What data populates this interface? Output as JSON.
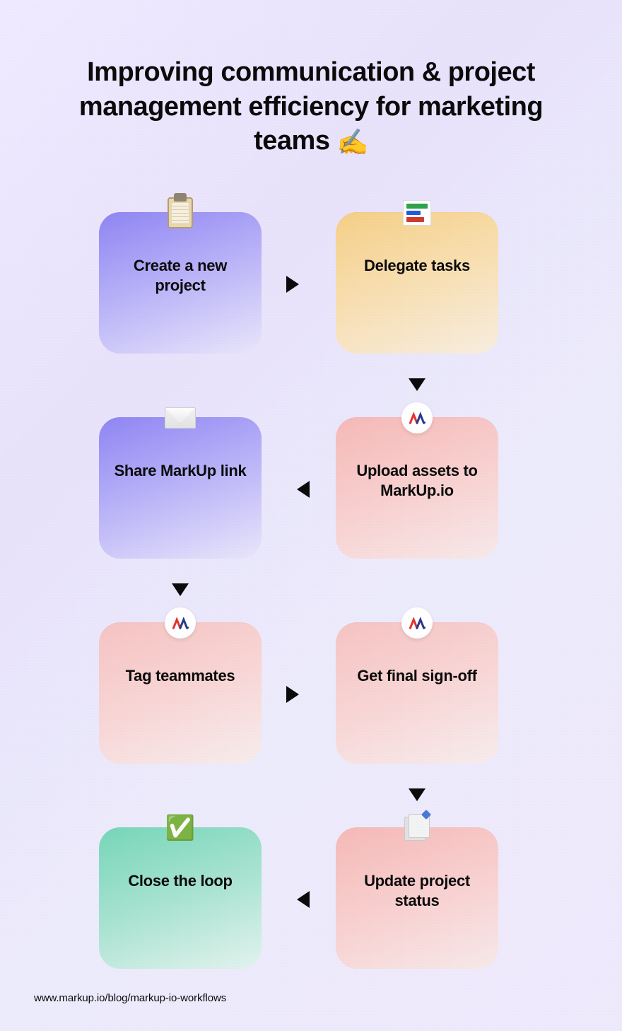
{
  "title": {
    "text": "Improving communication & project management efficiency for marketing teams",
    "emoji": "✍️"
  },
  "steps": [
    {
      "id": "create-project",
      "label": "Create a new project",
      "icon": "clipboard-icon",
      "color": "purple"
    },
    {
      "id": "delegate-tasks",
      "label": "Delegate tasks",
      "icon": "bars-icon",
      "color": "orange"
    },
    {
      "id": "upload-assets",
      "label": "Upload assets to MarkUp.io",
      "icon": "markup-logo-icon",
      "color": "pink"
    },
    {
      "id": "share-link",
      "label": "Share MarkUp link",
      "icon": "envelope-icon",
      "color": "purple"
    },
    {
      "id": "tag-teammates",
      "label": "Tag teammates",
      "icon": "markup-logo-icon",
      "color": "pink"
    },
    {
      "id": "final-signoff",
      "label": "Get final sign-off",
      "icon": "markup-logo-icon",
      "color": "pink"
    },
    {
      "id": "update-status",
      "label": "Update project status",
      "icon": "document-stack-icon",
      "color": "pink"
    },
    {
      "id": "close-loop",
      "label": "Close the loop",
      "icon": "check-icon",
      "color": "teal"
    }
  ],
  "flow_arrows": [
    {
      "from": "create-project",
      "to": "delegate-tasks",
      "dir": "right"
    },
    {
      "from": "delegate-tasks",
      "to": "upload-assets",
      "dir": "down"
    },
    {
      "from": "upload-assets",
      "to": "share-link",
      "dir": "left"
    },
    {
      "from": "share-link",
      "to": "tag-teammates",
      "dir": "down"
    },
    {
      "from": "tag-teammates",
      "to": "final-signoff",
      "dir": "right"
    },
    {
      "from": "final-signoff",
      "to": "update-status",
      "dir": "down"
    },
    {
      "from": "update-status",
      "to": "close-loop",
      "dir": "left"
    }
  ],
  "footer": {
    "url": "www.markup.io/blog/markup-io-workflows"
  },
  "colors": {
    "purple": "#8e85f3",
    "orange": "#f5cf86",
    "pink": "#f5b9b7",
    "teal": "#76d6b8",
    "text": "#0a0a0a"
  }
}
